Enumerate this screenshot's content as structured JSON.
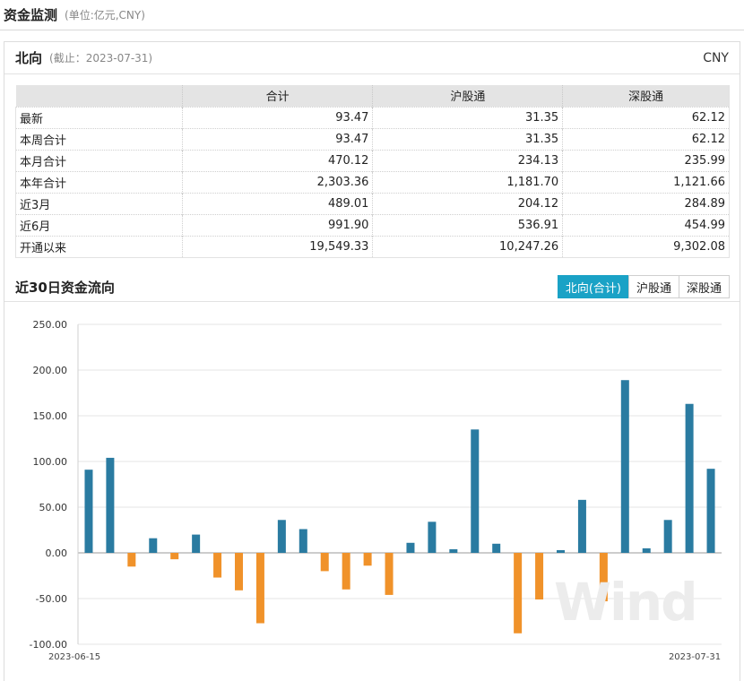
{
  "header": {
    "title": "资金监测",
    "unit": "(单位:亿元,CNY)"
  },
  "panel": {
    "title": "北向",
    "as_of": "(截止：2023-07-31)",
    "currency": "CNY"
  },
  "table": {
    "columns": [
      "",
      "合计",
      "沪股通",
      "深股通"
    ],
    "rows": [
      {
        "label": "最新",
        "values": [
          "93.47",
          "31.35",
          "62.12"
        ]
      },
      {
        "label": "本周合计",
        "values": [
          "93.47",
          "31.35",
          "62.12"
        ]
      },
      {
        "label": "本月合计",
        "values": [
          "470.12",
          "234.13",
          "235.99"
        ]
      },
      {
        "label": "本年合计",
        "values": [
          "2,303.36",
          "1,181.70",
          "1,121.66"
        ]
      },
      {
        "label": "近3月",
        "values": [
          "489.01",
          "204.12",
          "284.89"
        ]
      },
      {
        "label": "近6月",
        "values": [
          "991.90",
          "536.91",
          "454.99"
        ]
      },
      {
        "label": "开通以来",
        "values": [
          "19,549.33",
          "10,247.26",
          "9,302.08"
        ]
      }
    ]
  },
  "section": {
    "title": "近30日资金流向",
    "tabs": [
      {
        "label": "北向(合计)",
        "active": true
      },
      {
        "label": "沪股通",
        "active": false
      },
      {
        "label": "深股通",
        "active": false
      }
    ]
  },
  "watermark": "Wind",
  "chart_data": {
    "type": "bar",
    "x_start_label": "2023-06-15",
    "x_end_label": "2023-07-31",
    "yticks": [
      "250.00",
      "200.00",
      "150.00",
      "100.00",
      "50.00",
      "0.00",
      "-50.00",
      "-100.00"
    ],
    "ylim": [
      -100,
      250
    ],
    "values": [
      91,
      104,
      -15,
      16,
      -7,
      20,
      -27,
      -41,
      -77,
      36,
      26,
      -20,
      -40,
      -14,
      -46,
      11,
      34,
      4,
      135,
      10,
      -88,
      -51,
      3,
      58,
      -53,
      189,
      5,
      36,
      163,
      92
    ],
    "colors": {
      "positive": "#2a7ba1",
      "negative": "#f0922a"
    },
    "grid": true
  }
}
